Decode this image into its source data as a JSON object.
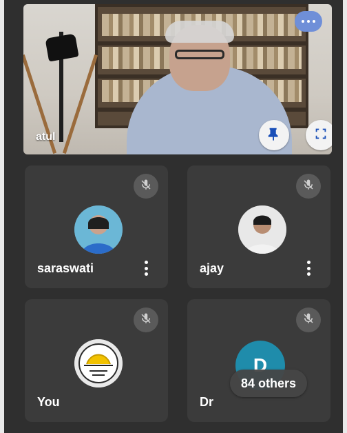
{
  "main_speaker": {
    "name": "atul",
    "icons": {
      "more": "more-icon",
      "pin": "pin-icon",
      "fullscreen": "fullscreen-icon"
    }
  },
  "tiles": [
    {
      "name": "saraswati",
      "muted": true,
      "avatar": "photo-avatar"
    },
    {
      "name": "ajay",
      "muted": true,
      "avatar": "photo-avatar"
    },
    {
      "name": "You",
      "muted": true,
      "avatar": "logo-avatar"
    },
    {
      "name": "Dr",
      "muted": true,
      "avatar_letter": "D",
      "others_text": "84 others"
    }
  ],
  "colors": {
    "accent_blue": "#6f8fd8",
    "tile_bg": "#3b3b3b",
    "letter_avatar": "#1f8cab"
  }
}
